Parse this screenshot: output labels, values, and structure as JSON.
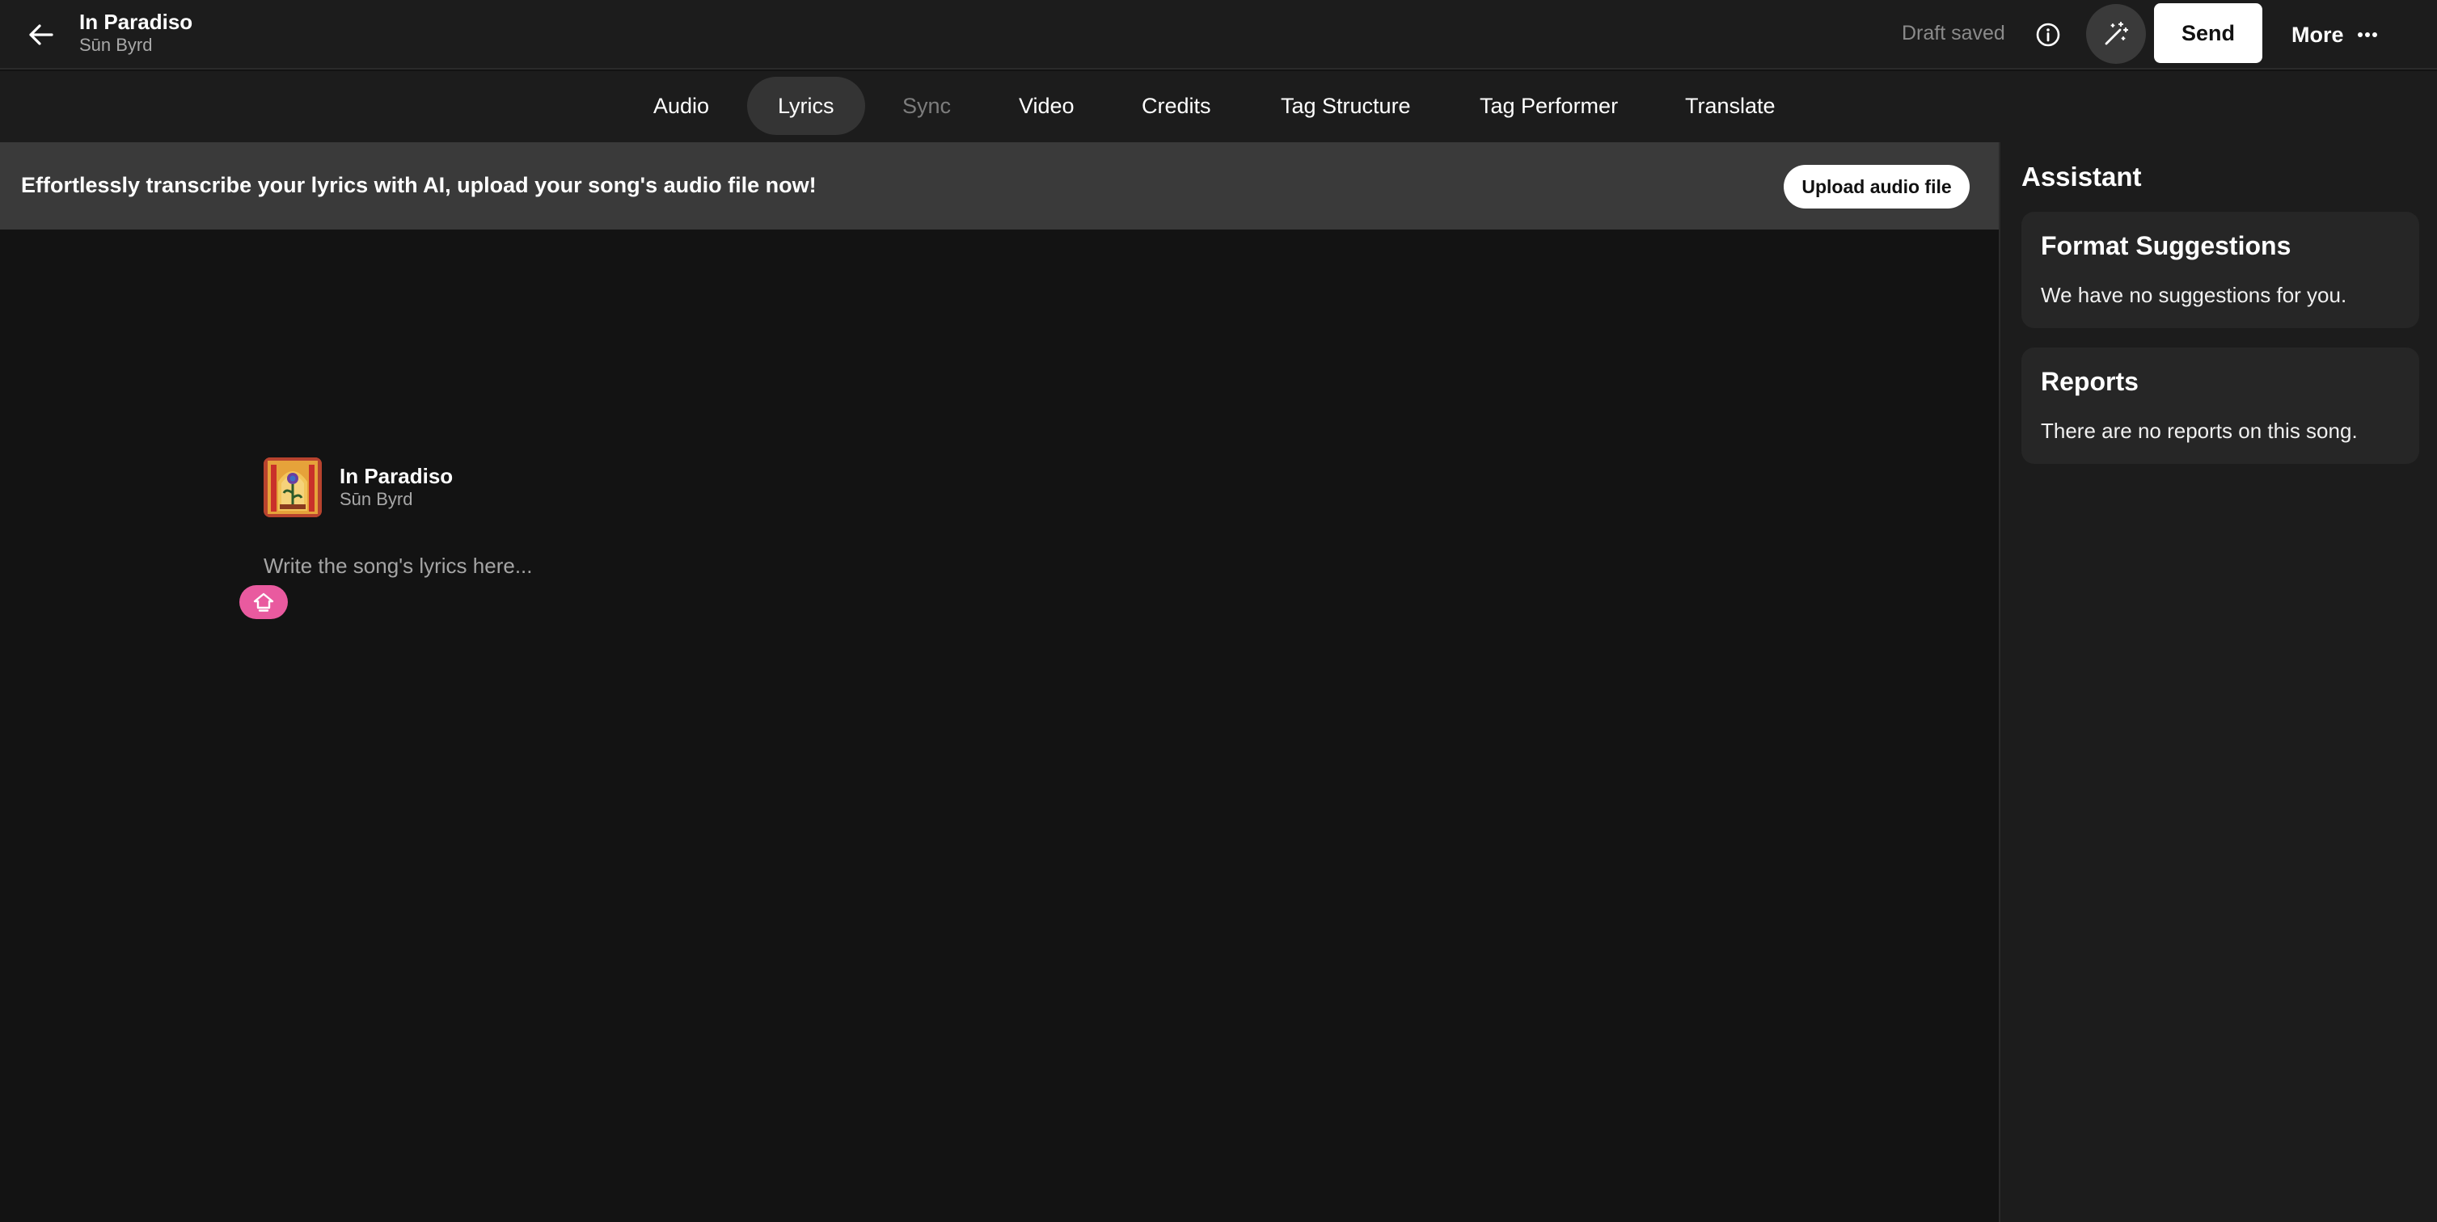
{
  "header": {
    "song_title": "In Paradiso",
    "artist": "Sūn Byrd",
    "draft_status": "Draft saved",
    "send_label": "Send",
    "more_label": "More",
    "icons": {
      "back": "arrow-left-icon",
      "info": "info-icon",
      "magic": "magic-wand-icon",
      "more": "ellipsis-icon"
    }
  },
  "tabs": [
    {
      "label": "Audio",
      "state": "normal"
    },
    {
      "label": "Lyrics",
      "state": "active"
    },
    {
      "label": "Sync",
      "state": "disabled"
    },
    {
      "label": "Video",
      "state": "normal"
    },
    {
      "label": "Credits",
      "state": "normal"
    },
    {
      "label": "Tag Structure",
      "state": "normal"
    },
    {
      "label": "Tag Performer",
      "state": "normal"
    },
    {
      "label": "Translate",
      "state": "normal"
    }
  ],
  "banner": {
    "text": "Effortlessly transcribe your lyrics with AI, upload your song's audio file now!",
    "button_label": "Upload audio file"
  },
  "editor": {
    "song_title": "In Paradiso",
    "artist": "Sūn Byrd",
    "lyrics_value": "",
    "lyrics_placeholder": "Write the song's lyrics here...",
    "ai_button_icon": "home-up-icon"
  },
  "assistant": {
    "title": "Assistant",
    "cards": [
      {
        "heading": "Format Suggestions",
        "body": "We have no suggestions for you."
      },
      {
        "heading": "Reports",
        "body": "There are no reports on this song."
      }
    ]
  },
  "colors": {
    "background": "#131313",
    "topbar": "#1c1c1c",
    "banner": "#3a3a3a",
    "accent_pink": "#e95a9f",
    "card": "#262626"
  }
}
